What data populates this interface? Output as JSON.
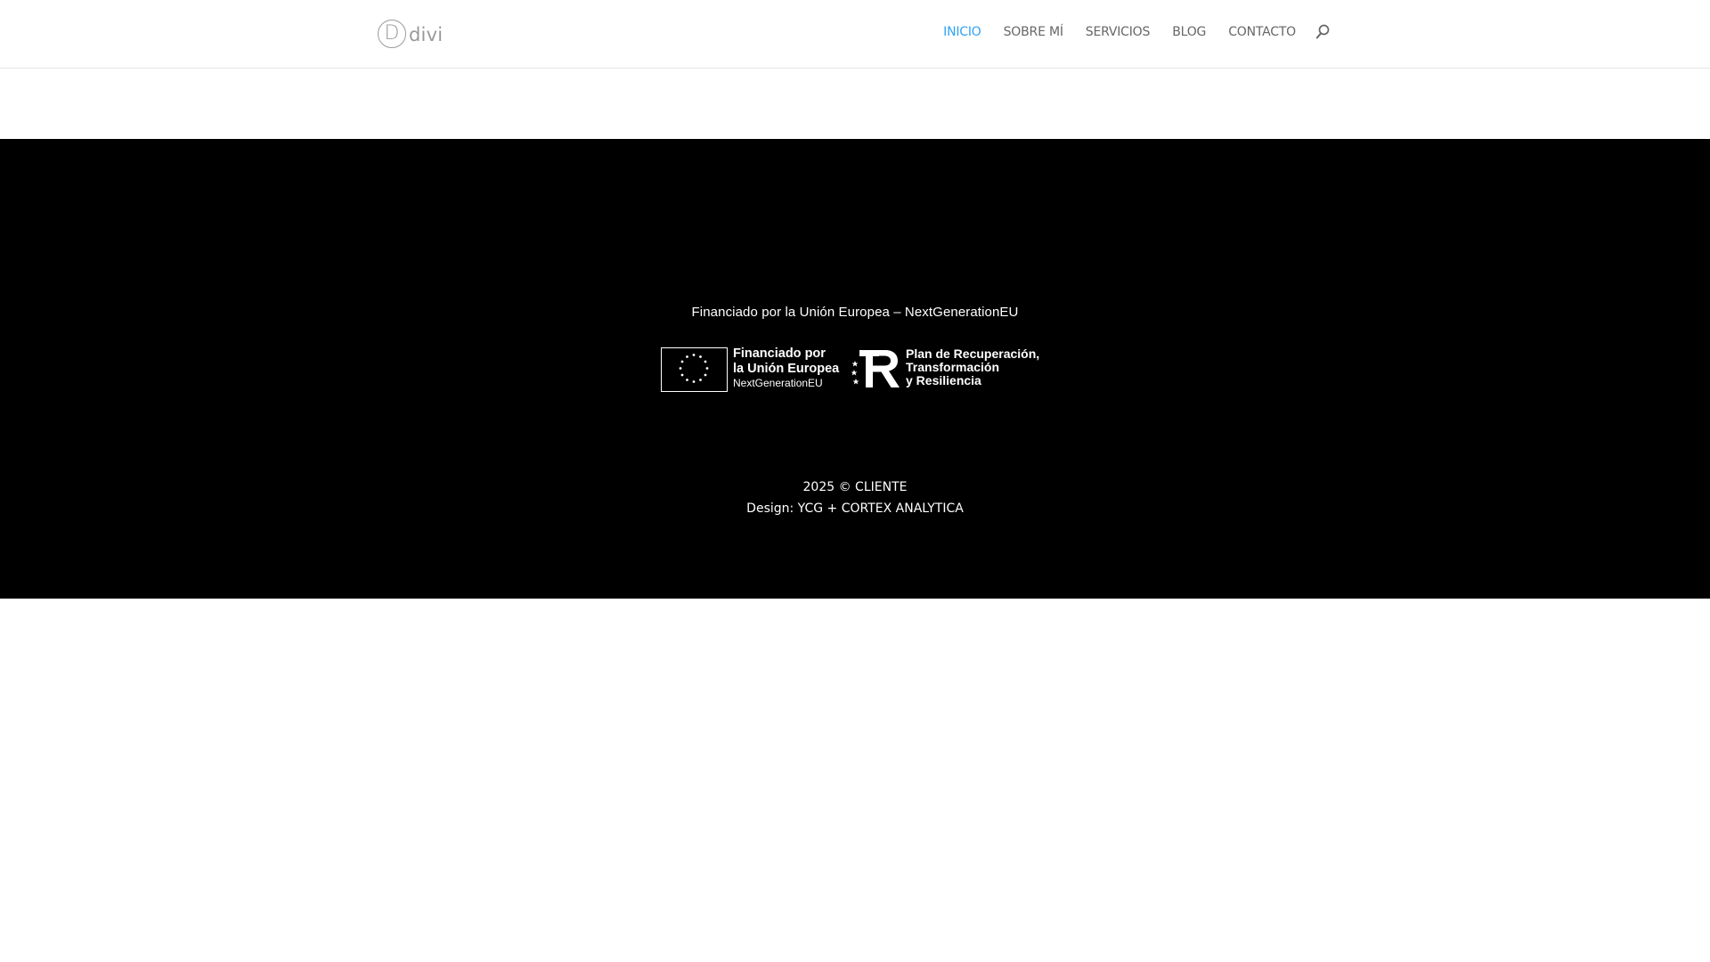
{
  "header": {
    "logo_text": "divi",
    "logo_mark": "D",
    "nav": [
      {
        "label": "INICIO",
        "active": true
      },
      {
        "label": "SOBRE MÍ",
        "active": false
      },
      {
        "label": "SERVICIOS",
        "active": false
      },
      {
        "label": "BLOG",
        "active": false
      },
      {
        "label": "CONTACTO",
        "active": false
      }
    ],
    "search_icon": "search-icon",
    "accent_color": "#2ea3f2",
    "nav_color": "#666666"
  },
  "footer": {
    "background": "#000000",
    "funding_line": "Financiado por la Unión Europea – NextGenerationEU",
    "eu_logo": {
      "line1": "Financiado por",
      "line2": "la Unión Europea",
      "line3": "NextGenerationEU"
    },
    "prtr_logo": {
      "line1": "Plan de Recuperación,",
      "line2": "Transformación",
      "line3": "y Resiliencia"
    },
    "copyright": "2025 © CLIENTE",
    "design_credit": "Design: YCG + CORTEX ANALYTICA"
  }
}
